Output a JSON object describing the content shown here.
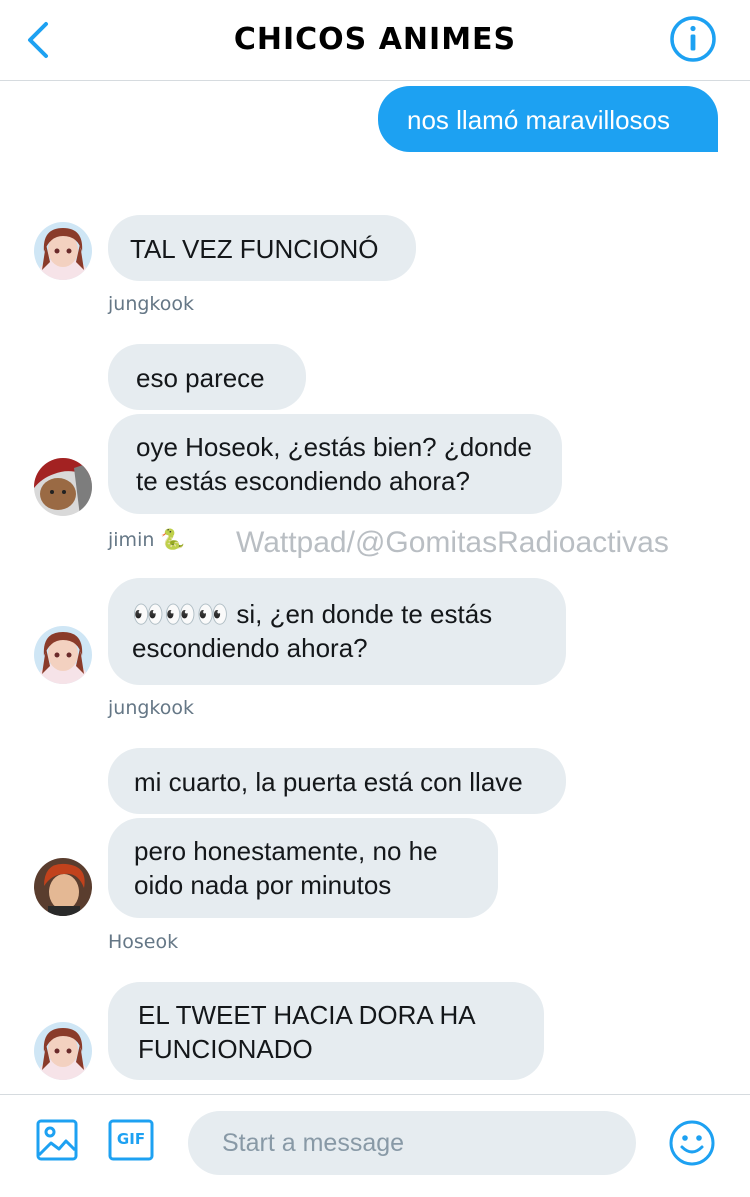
{
  "header": {
    "title": "CHICOS ANIMES",
    "back_icon": "chevron-left-icon",
    "info_icon": "info-icon"
  },
  "accent_color": "#1da1f2",
  "messages": [
    {
      "direction": "out",
      "text": "nos llamó maravillosos"
    },
    {
      "direction": "in",
      "sender": "jungkook",
      "text": "TAL VEZ FUNCIONÓ"
    },
    {
      "direction": "in",
      "sender": "jimin",
      "text": "eso parece"
    },
    {
      "direction": "in",
      "sender": "jimin",
      "text": "oye Hoseok, ¿estás bien? ¿donde te estás escondiendo ahora?"
    },
    {
      "direction": "in",
      "sender": "jungkook",
      "text": "👀👀👀 si, ¿en donde te estás escondiendo ahora?"
    },
    {
      "direction": "in",
      "sender": "Hoseok",
      "text": "mi cuarto, la puerta está con llave"
    },
    {
      "direction": "in",
      "sender": "Hoseok",
      "text": "pero honestamente, no he oido nada por minutos"
    },
    {
      "direction": "in",
      "sender": "jungkook",
      "text": "EL TWEET HACIA DORA HA FUNCIONADO"
    }
  ],
  "sender_labels": [
    "jungkook",
    "jimin",
    "jungkook",
    "Hoseok"
  ],
  "watermark": "Wattpad/@GomitasRadioactivas",
  "composer": {
    "placeholder": "Start a message",
    "gif_label": "GIF",
    "image_icon": "image-icon",
    "emoji_icon": "emoji-icon"
  }
}
